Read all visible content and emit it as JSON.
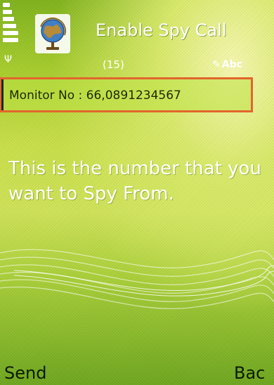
{
  "header": {
    "title": "Enable Spy Call",
    "char_count": "(15)",
    "input_mode": "Abc"
  },
  "field": {
    "label_value": "Monitor No : 66,0891234567"
  },
  "help_text": "This is the number that you want to Spy From.",
  "softkeys": {
    "left": "Send",
    "right": "Bac"
  },
  "icons": {
    "app": "globe-icon",
    "signal": "signal-strength-icon",
    "antenna": "antenna-icon",
    "edit": "pencil-icon"
  },
  "colors": {
    "focus_border": "#e2652c",
    "background": "#b8d63c",
    "softkey_text": "#0a1b00"
  }
}
